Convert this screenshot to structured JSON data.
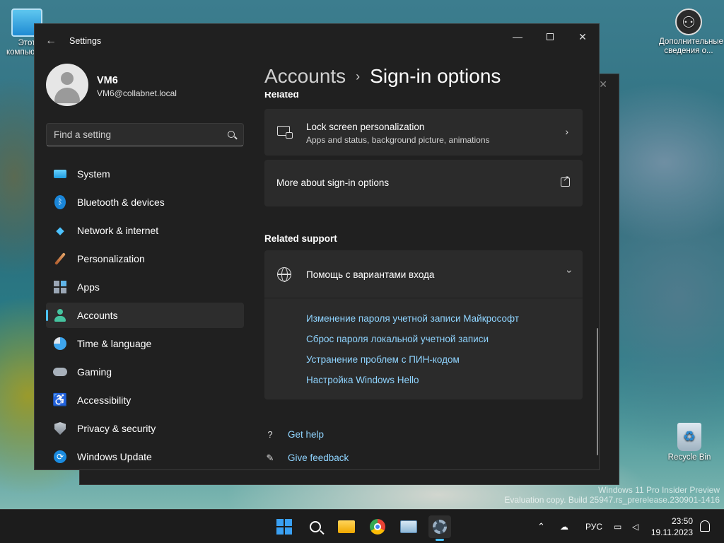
{
  "desktop": {
    "icons": {
      "this_pc": "Этот компьютер",
      "extra_info": "Дополнительные сведения о...",
      "recycle_bin": "Recycle Bin"
    },
    "watermark_line1": "Windows 11 Pro Insider Preview",
    "watermark_line2": "Evaluation copy. Build 25947.rs_prerelease.230901-1416"
  },
  "window": {
    "title": "Settings"
  },
  "profile": {
    "name": "VM6",
    "email": "VM6@collabnet.local"
  },
  "search": {
    "placeholder": "Find a setting"
  },
  "sidebar": {
    "items": [
      {
        "label": "System"
      },
      {
        "label": "Bluetooth & devices"
      },
      {
        "label": "Network & internet"
      },
      {
        "label": "Personalization"
      },
      {
        "label": "Apps"
      },
      {
        "label": "Accounts"
      },
      {
        "label": "Time & language"
      },
      {
        "label": "Gaming"
      },
      {
        "label": "Accessibility"
      },
      {
        "label": "Privacy & security"
      },
      {
        "label": "Windows Update"
      }
    ],
    "active": "Accounts"
  },
  "breadcrumb": {
    "parent": "Accounts",
    "separator": "›",
    "current": "Sign-in options"
  },
  "related": {
    "label": "Related",
    "lock_screen": {
      "title": "Lock screen personalization",
      "subtitle": "Apps and status, background picture, animations"
    },
    "more_about": {
      "title": "More about sign-in options"
    }
  },
  "related_support": {
    "label": "Related support",
    "help_title": "Помощь с вариантами входа",
    "links": [
      "Изменение пароля учетной записи Майкрософт",
      "Сброс пароля локальной учетной записи",
      "Устранение проблем с ПИН-кодом",
      "Настройка Windows Hello"
    ]
  },
  "footer": {
    "get_help": "Get help",
    "give_feedback": "Give feedback"
  },
  "taskbar": {
    "language": "РУС",
    "time": "23:50",
    "date": "19.11.2023"
  },
  "colors": {
    "accent": "#4cc2ff",
    "link": "#8fd4ff",
    "window_bg": "#202020",
    "card_bg": "#2b2b2b"
  }
}
